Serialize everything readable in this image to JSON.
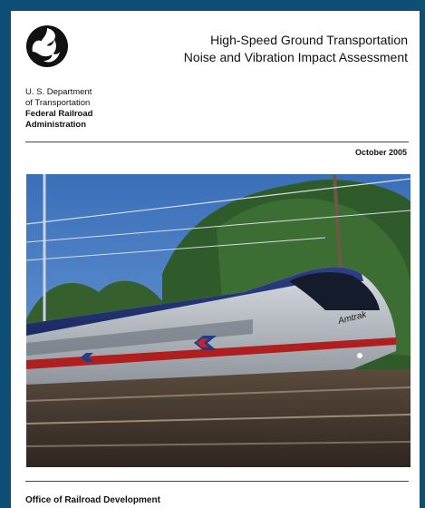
{
  "document": {
    "title_line1": "High-Speed Ground Transportation",
    "title_line2": "Noise and Vibration Impact Assessment",
    "agency_line1": "U. S. Department",
    "agency_line2": "of Transportation",
    "agency_line3": "Federal Railroad",
    "agency_line4": "Administration",
    "date": "October 2005",
    "train_label": "Amtrak",
    "office": "Office of Railroad Development"
  },
  "colors": {
    "frame": "#0e4f78",
    "page": "#ffffff",
    "text": "#111111"
  },
  "icons": {
    "logo": "dot-logo-icon"
  }
}
